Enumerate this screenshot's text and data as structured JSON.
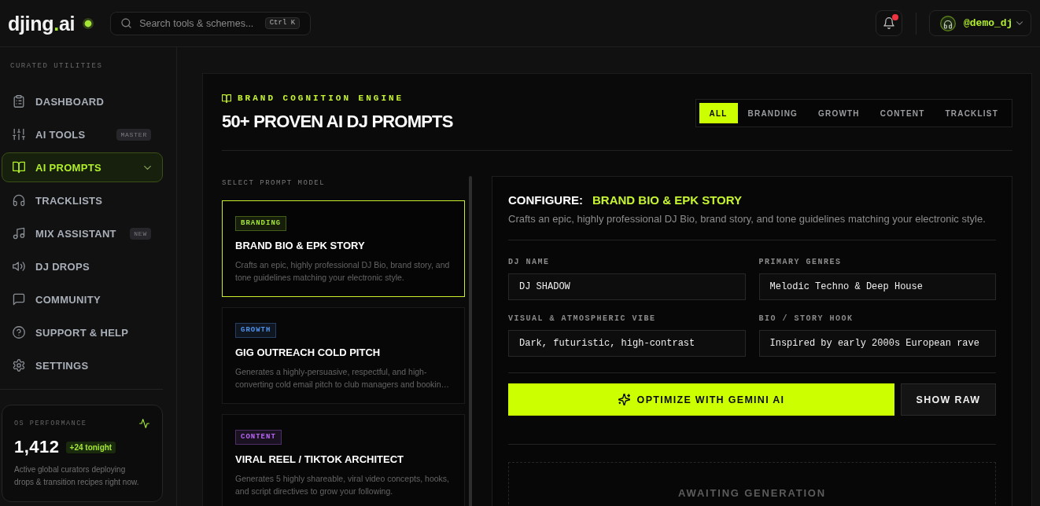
{
  "topbar": {
    "logo": {
      "before": "djing",
      "accent": ".",
      "after": "ai"
    },
    "live": true,
    "search": {
      "placeholder": "Search tools & schemes...",
      "shortcut": "Ctrl K"
    },
    "notifications": {
      "unread": true
    },
    "user": {
      "handle": "@demo_dj"
    }
  },
  "sidebar": {
    "section_label": "CURATED UTILITIES",
    "items": [
      {
        "label": "DASHBOARD",
        "selected": false
      },
      {
        "label": "AI TOOLS",
        "badge": "MASTER",
        "selected": false
      },
      {
        "label": "AI PROMPTS",
        "selected": true
      },
      {
        "label": "TRACKLISTS",
        "selected": false
      },
      {
        "label": "MIX ASSISTANT",
        "badge": "NEW",
        "selected": false
      },
      {
        "label": "DJ DROPS",
        "selected": false
      },
      {
        "label": "COMMUNITY",
        "selected": false
      },
      {
        "label": "SUPPORT & HELP",
        "selected": false
      },
      {
        "label": "SETTINGS",
        "selected": false
      }
    ],
    "stats": {
      "label": "OS PERFORMANCE",
      "value": "1,412",
      "delta": "+24 tonight",
      "description": "Active global curators deploying drops & transition recipes right now."
    }
  },
  "header": {
    "eyebrow": "BRAND COGNITION ENGINE",
    "title": "50+ PROVEN AI DJ PROMPTS",
    "filters": [
      {
        "label": "ALL",
        "selected": true
      },
      {
        "label": "BRANDING",
        "selected": false
      },
      {
        "label": "GROWTH",
        "selected": false
      },
      {
        "label": "CONTENT",
        "selected": false
      },
      {
        "label": "TRACKLIST",
        "selected": false
      }
    ]
  },
  "prompt_list": {
    "label": "SELECT PROMPT MODEL",
    "prompts": [
      {
        "tag": "BRANDING",
        "color": "#a3e635",
        "title": "BRAND BIO & EPK STORY",
        "description": "Crafts an epic, highly professional DJ Bio, brand story, and tone guidelines matching your electronic style.",
        "selected": true
      },
      {
        "tag": "GROWTH",
        "color": "#4f94f0",
        "title": "GIG OUTREACH COLD PITCH",
        "description": "Generates a highly-persuasive, respectful, and high-converting cold email pitch to club managers and bookin…",
        "selected": false
      },
      {
        "tag": "CONTENT",
        "color": "#b866f5",
        "title": "VIRAL REEL / TIKTOK ARCHITECT",
        "description": "Generates 5 highly shareable, viral video concepts, hooks, and script directives to grow your following.",
        "selected": false
      }
    ]
  },
  "config": {
    "label": "CONFIGURE:",
    "title": "BRAND BIO & EPK STORY",
    "description": "Crafts an epic, highly professional DJ Bio, brand story, and tone guidelines matching your electronic style.",
    "fields": [
      {
        "label": "DJ NAME",
        "value": "DJ SHADOW"
      },
      {
        "label": "PRIMARY GENRES",
        "value": "Melodic Techno & Deep House"
      },
      {
        "label": "VISUAL & ATMOSPHERIC VIBE",
        "value": "Dark, futuristic, high-contrast"
      },
      {
        "label": "BIO / STORY HOOK",
        "value": "Inspired by early 2000s European rave"
      }
    ],
    "primary_action": "OPTIMIZE WITH GEMINI AI",
    "secondary_action": "SHOW RAW",
    "output": {
      "status": "AWAITING GENERATION"
    }
  }
}
